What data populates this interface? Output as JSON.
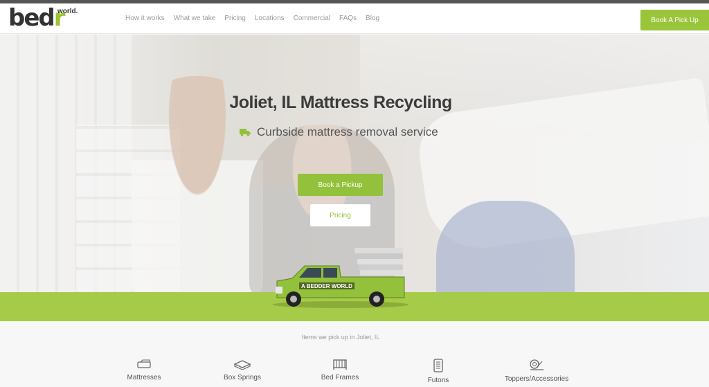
{
  "brand": {
    "logo_main": "bed",
    "logo_accent": "r",
    "logo_world": "world.",
    "accent_color": "#9ac53b"
  },
  "nav": {
    "items": [
      "How it works",
      "What we take",
      "Pricing",
      "Locations",
      "Commercial",
      "FAQs",
      "Blog"
    ]
  },
  "header": {
    "cta_label": "Book A Pick Up"
  },
  "hero": {
    "title": "Joliet, IL Mattress Recycling",
    "subtitle": "Curbside mattress removal service",
    "subtitle_icon": "truck-icon",
    "book_button": "Book a Pickup",
    "pricing_button": "Pricing",
    "truck_text": "A BEDDER WORLD"
  },
  "items": {
    "title": "Items we pick up in Joliet, IL",
    "list": [
      {
        "label": "Mattresses",
        "icon": "mattress-icon"
      },
      {
        "label": "Box Springs",
        "icon": "box-spring-icon"
      },
      {
        "label": "Bed Frames",
        "icon": "bed-frame-icon"
      },
      {
        "label": "Futons",
        "icon": "futon-icon"
      },
      {
        "label": "Toppers/Accessories",
        "icon": "topper-icon"
      }
    ]
  }
}
